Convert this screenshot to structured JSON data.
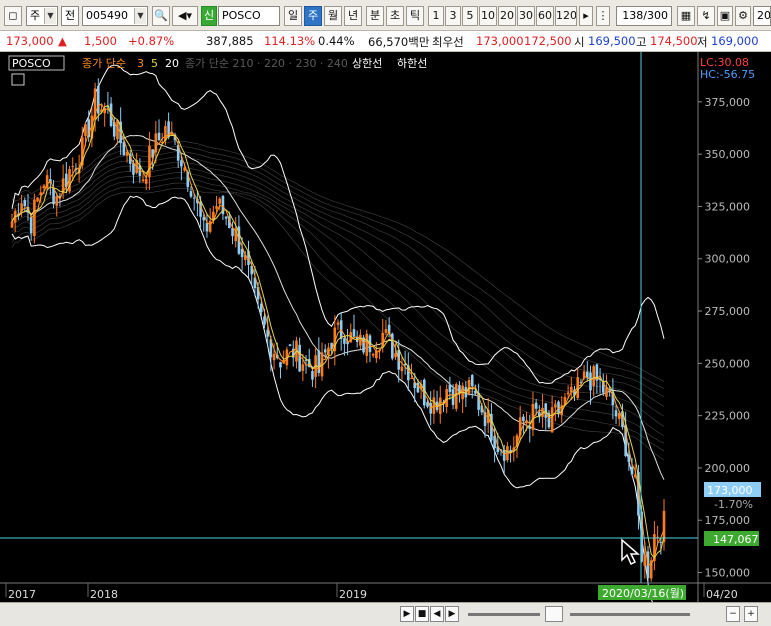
{
  "toolbar": {
    "mode": "주",
    "market": "전",
    "code": "005490",
    "badge": "신",
    "name": "POSCO",
    "periods": [
      "일",
      "주",
      "월",
      "년"
    ],
    "active_period": "주",
    "intraday": [
      "분",
      "초",
      "틱"
    ],
    "numbers": [
      "1",
      "3",
      "5",
      "10",
      "20",
      "30",
      "60",
      "120"
    ],
    "count": "138",
    "count_total": "/300",
    "right_label": "20"
  },
  "quote": {
    "price": "173,000",
    "change_arrow": "▲",
    "change": "1,500",
    "change_pct": "+0.87%",
    "volume": "387,885",
    "vol_ratio": "114.13%",
    "turnover": "0.44%",
    "amount": "66,570백만",
    "best_label": "최우선",
    "best_ask": "173,000",
    "best_bid": "172,500",
    "open_label": "시",
    "open": "169,500",
    "high_label": "고",
    "high": "174,500",
    "low_label": "저",
    "low": "169,000"
  },
  "legend": {
    "symbol": "POSCO",
    "ma_title": "종가 단순",
    "ma_periods": [
      "3",
      "5",
      "20"
    ],
    "ma2_title": "종가 단순 210 · 220 · 230 · 240",
    "upper": "상한선",
    "lower": "하한선",
    "lc": "LC:30.08",
    "hc": "HC:-56.75"
  },
  "chart_data": {
    "type": "candlestick",
    "y_axis_ticks": [
      "375,000",
      "350,000",
      "325,000",
      "300,000",
      "275,000",
      "250,000",
      "225,000",
      "200,000",
      "175,000",
      "150,000"
    ],
    "ylim": [
      145000,
      395000
    ],
    "x_axis_ticks": [
      "2017",
      "2018",
      "2019",
      "2020/03/16(월)",
      "04/20"
    ],
    "current_price_label": "173,000",
    "current_change_label": "-1.70%",
    "crosshair_price_label": "147,067",
    "crosshair_date_label": "2020/03/16(월)",
    "colors": {
      "up": "#ff7a1a",
      "down": "#8ecdf5",
      "band": "#ffffff",
      "ma": "#e8d44a",
      "crosshair": "#4fd0e0"
    }
  },
  "status": {
    "buttons": [
      "▶",
      "■",
      "◀",
      "▶",
      "−",
      "+"
    ]
  }
}
